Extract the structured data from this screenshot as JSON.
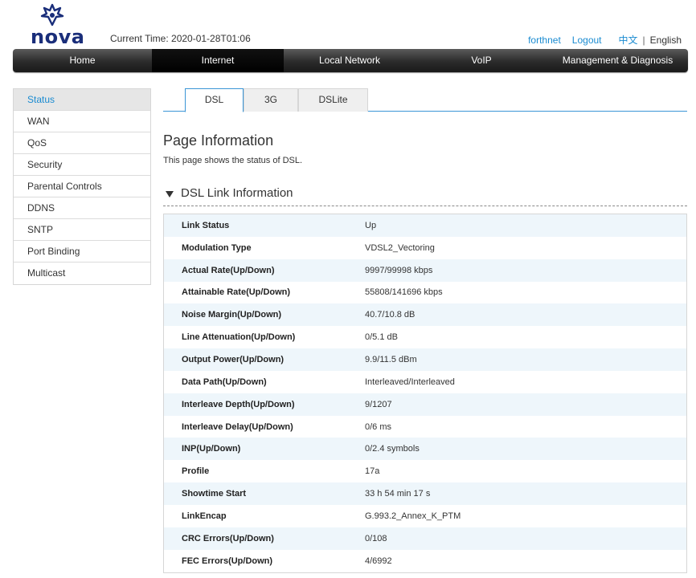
{
  "header": {
    "logo_text": "nova",
    "current_time": "Current Time: 2020-01-28T01:06",
    "links": {
      "user": "forthnet",
      "logout": "Logout",
      "lang_zh": "中文",
      "separator": "|",
      "lang_en": "English"
    }
  },
  "nav": {
    "items": [
      {
        "label": "Home"
      },
      {
        "label": "Internet"
      },
      {
        "label": "Local Network"
      },
      {
        "label": "VoIP"
      },
      {
        "label": "Management & Diagnosis"
      }
    ]
  },
  "sidebar": {
    "items": [
      {
        "label": "Status"
      },
      {
        "label": "WAN"
      },
      {
        "label": "QoS"
      },
      {
        "label": "Security"
      },
      {
        "label": "Parental Controls"
      },
      {
        "label": "DDNS"
      },
      {
        "label": "SNTP"
      },
      {
        "label": "Port Binding"
      },
      {
        "label": "Multicast"
      }
    ]
  },
  "tabs": [
    {
      "label": "DSL"
    },
    {
      "label": "3G"
    },
    {
      "label": "DSLite"
    }
  ],
  "page": {
    "title": "Page Information",
    "description": "This page shows the status of DSL.",
    "section_title": "DSL Link Information"
  },
  "table": {
    "rows": [
      {
        "key": "Link Status",
        "value": "Up"
      },
      {
        "key": "Modulation Type",
        "value": "VDSL2_Vectoring"
      },
      {
        "key": "Actual Rate(Up/Down)",
        "value": "9997/99998 kbps"
      },
      {
        "key": "Attainable Rate(Up/Down)",
        "value": "55808/141696 kbps"
      },
      {
        "key": "Noise Margin(Up/Down)",
        "value": "40.7/10.8 dB"
      },
      {
        "key": "Line Attenuation(Up/Down)",
        "value": "0/5.1 dB"
      },
      {
        "key": "Output Power(Up/Down)",
        "value": "9.9/11.5 dBm"
      },
      {
        "key": "Data Path(Up/Down)",
        "value": "Interleaved/Interleaved"
      },
      {
        "key": "Interleave Depth(Up/Down)",
        "value": "9/1207"
      },
      {
        "key": "Interleave Delay(Up/Down)",
        "value": "0/6 ms"
      },
      {
        "key": "INP(Up/Down)",
        "value": "0/2.4 symbols"
      },
      {
        "key": "Profile",
        "value": "17a"
      },
      {
        "key": "Showtime Start",
        "value": "33 h 54 min 17 s"
      },
      {
        "key": "LinkEncap",
        "value": "G.993.2_Annex_K_PTM"
      },
      {
        "key": "CRC Errors(Up/Down)",
        "value": "0/108"
      },
      {
        "key": "FEC Errors(Up/Down)",
        "value": "4/6992"
      }
    ]
  }
}
